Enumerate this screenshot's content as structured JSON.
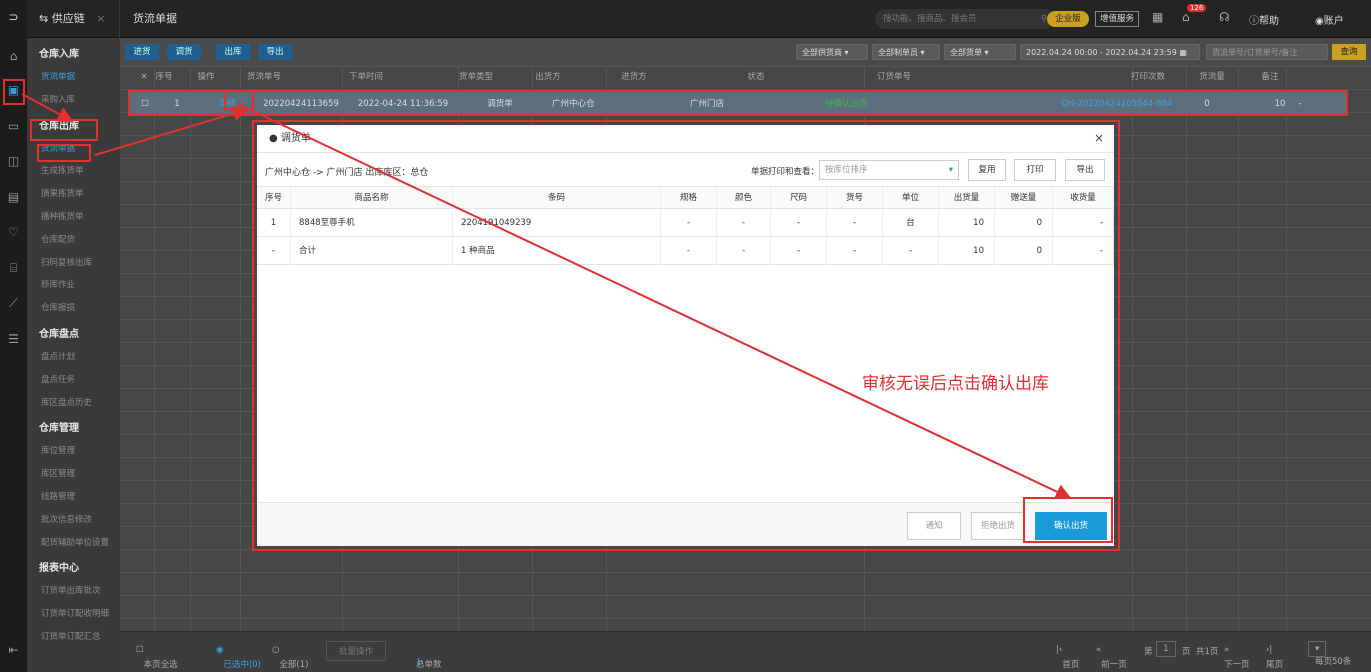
{
  "app": {
    "logo": "⊃",
    "module_tab": "供应链",
    "module_close": "×",
    "page_tab": "货流单据"
  },
  "topbar": {
    "search_placeholder": "搜功能、搜商品、搜会员",
    "badge_enterprise": "企业版",
    "badge_addon": "增值服务",
    "notif_count": "126",
    "help": "帮助",
    "account": "账户"
  },
  "sidebar": {
    "groups": [
      {
        "title": "仓库入库",
        "items": [
          "货流单据",
          "采购入库"
        ]
      },
      {
        "title": "仓库出库",
        "items": [
          "货流单据",
          "生成拣货单",
          "摘果拣货单",
          "播种拣货单",
          "仓库配货",
          "扫码复核出库",
          "移库作业",
          "仓库报损"
        ]
      },
      {
        "title": "仓库盘点",
        "items": [
          "盘点计划",
          "盘点任务",
          "库区盘点历史"
        ]
      },
      {
        "title": "仓库管理",
        "items": [
          "库位管理",
          "库区管理",
          "线路管理",
          "批次信息修改",
          "配货辅助单位设置"
        ]
      },
      {
        "title": "报表中心",
        "items": [
          "订货单出库批次",
          "订货单订配收明细",
          "订货单订配汇总"
        ]
      }
    ]
  },
  "toolbar": {
    "buttons": [
      "进货",
      "调货",
      "出库",
      "导出"
    ],
    "filters": [
      "全部供货商",
      "全部制单员",
      "全部货单"
    ],
    "date_from": "2022.04.24 00:00",
    "date_sep": "-",
    "date_to": "2022.04.24 23:59",
    "search_placeholder": "货流单号/订货单号/备注",
    "query": "查询"
  },
  "table": {
    "headers": [
      "序号",
      "操作",
      "货流单号",
      "下单时间",
      "货单类型",
      "出货方",
      "进货方",
      "状态",
      "订货单号",
      "打印次数",
      "货流量",
      "备注"
    ],
    "row": {
      "index": "1",
      "action": "详细",
      "flow_no": "20220424113659",
      "order_time": "2022-04-24 11:36:59",
      "type": "调货单",
      "from": "广州中心仓",
      "to": "广州门店",
      "status": "待确认出货",
      "order_no": "DH-20220424105544-884",
      "print_count": "0",
      "qty": "10",
      "remark": "-"
    }
  },
  "footer": {
    "select_page": "本页全选",
    "selected": "已选中(0)",
    "all": "全部(1)",
    "batch": "批量操作",
    "total_label": "总单数",
    "total": "1",
    "first": "首页",
    "prev": "前一页",
    "page_label": "第",
    "page": "1",
    "page_unit": "页",
    "total_pages": "共1页",
    "next": "下一页",
    "last": "尾页",
    "per_page": "每页50条"
  },
  "modal": {
    "title": "调货单",
    "close": "×",
    "route": "广州中心仓 -> 广州门店   出库库区：总仓",
    "print_label": "单据打印和查看：",
    "sort_placeholder": "按库位排序",
    "buttons": [
      "复用",
      "打印",
      "导出"
    ],
    "headers": [
      "序号",
      "商品名称",
      "条码",
      "规格",
      "颜色",
      "尺码",
      "货号",
      "单位",
      "出货量",
      "赠送量",
      "收货量"
    ],
    "rows": [
      [
        "1",
        "8848至尊手机",
        "2204191049239",
        "-",
        "-",
        "-",
        "-",
        "台",
        "10",
        "0",
        "-"
      ],
      [
        "-",
        "合计",
        "1 种商品",
        "-",
        "-",
        "-",
        "-",
        "-",
        "10",
        "0",
        "-"
      ]
    ],
    "footer_buttons": [
      "通知",
      "拒绝出货",
      "确认出货"
    ]
  },
  "annotation": "审核无误后点击确认出库",
  "colors": {
    "accent": "#1a9ad6",
    "annotation": "#e03030",
    "status_green": "#3db34a",
    "link_blue": "#3aa0e0"
  }
}
